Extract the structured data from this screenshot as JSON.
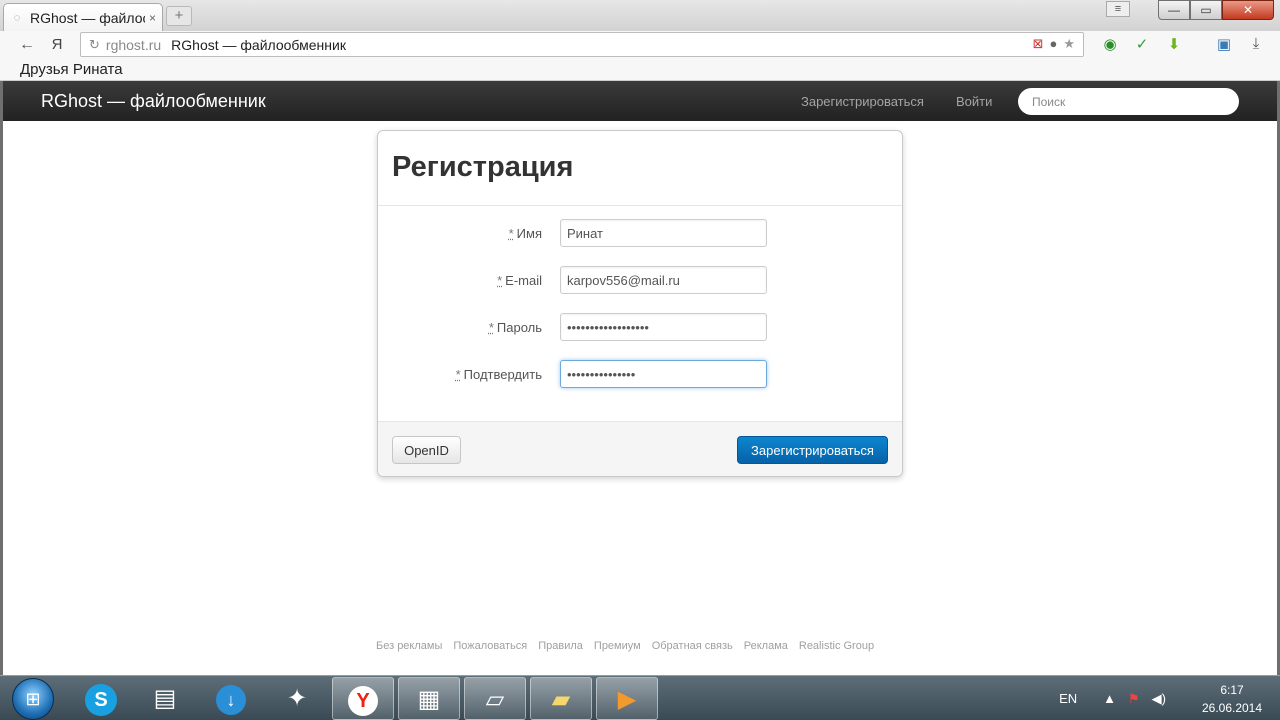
{
  "browser": {
    "tab_title": "RGhost — файлоо",
    "tab_close": "×",
    "new_tab": "+",
    "back": "←",
    "yandex_logo": "Я",
    "reload": "↻",
    "url_domain": "rghost.ru",
    "url_title": "RGhost — файлообменник",
    "bookmark_label": "Друзья Рината",
    "window_buttons": {
      "minimize": "—",
      "maximize": "▭",
      "close": "✕"
    },
    "menu": "≡",
    "star": "★"
  },
  "site": {
    "brand": "RGhost — файлообменник",
    "nav_register": "Зарегистрироваться",
    "nav_login": "Войти",
    "search_placeholder": "Поиск"
  },
  "form": {
    "title": "Регистрация",
    "required_mark": "*",
    "fields": [
      {
        "label": "Имя",
        "value": "Ринат"
      },
      {
        "label": "E-mail",
        "value": "karpov556@mail.ru"
      },
      {
        "label": "Пароль",
        "value": "••••••••••••••••••"
      },
      {
        "label": "Подтвердить",
        "value": "•••••••••••••••"
      }
    ],
    "openid_button": "OpenID",
    "submit_button": "Зарегистрироваться"
  },
  "footer": {
    "links": [
      "Без рекламы",
      "Пожаловаться",
      "Правила",
      "Премиум",
      "Обратная связь",
      "Реклама",
      "Realistic Group"
    ]
  },
  "taskbar": {
    "language": "EN",
    "time": "6:17",
    "date": "26.06.2014",
    "start_icon": "windows-start-icon",
    "apps": [
      "skype-icon",
      "media-app-icon",
      "download-app-icon",
      "torrent-app-icon",
      "yandex-browser-icon",
      "film-app-icon",
      "notepad-icon",
      "folder-icon",
      "player-icon"
    ]
  }
}
